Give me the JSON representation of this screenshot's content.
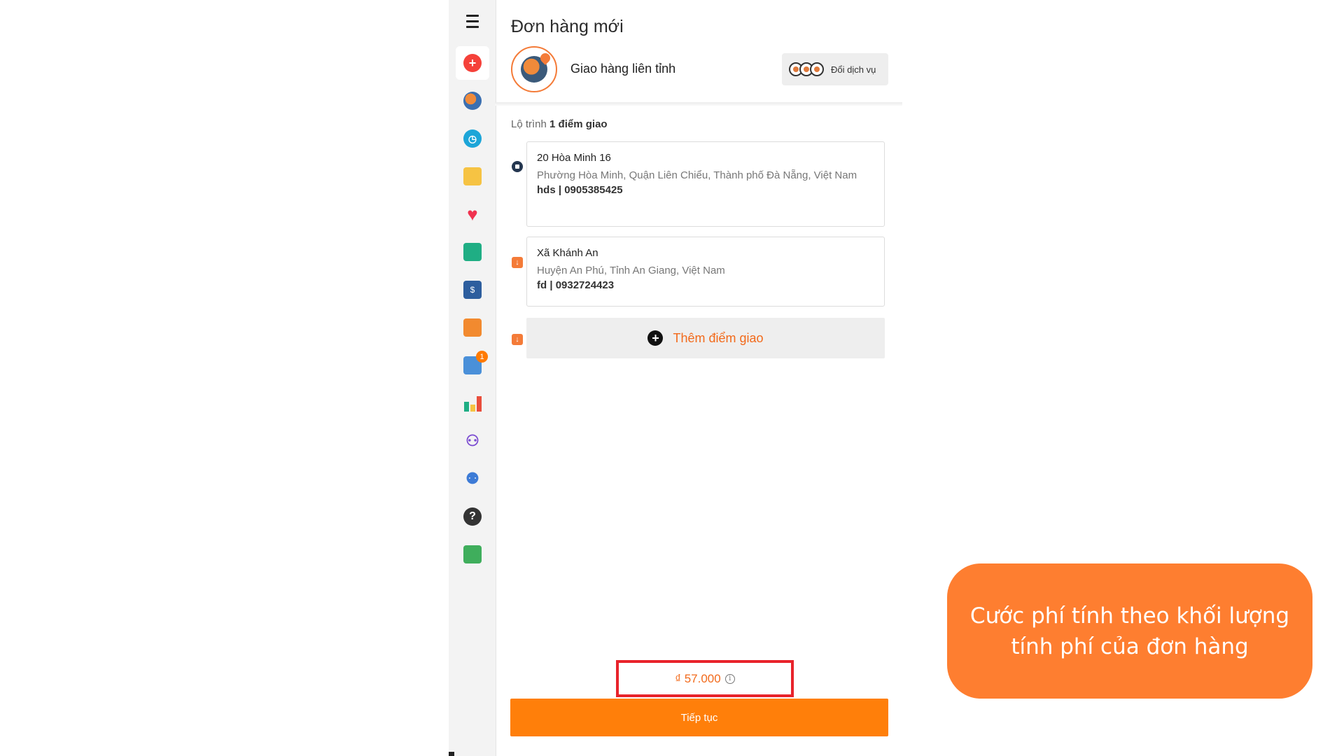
{
  "sidebar": {
    "menu_icon": "hamburger-menu-icon",
    "items": [
      {
        "name": "new-order",
        "icon": "plus-circle-icon",
        "color": "#f5413a",
        "active": true
      },
      {
        "name": "delivery",
        "icon": "delivery-globe-icon",
        "color": "#3b6fb0"
      },
      {
        "name": "history",
        "icon": "clock-icon",
        "color": "#1ca5d8"
      },
      {
        "name": "documents",
        "icon": "folder-icon",
        "color": "#f6c343"
      },
      {
        "name": "favorites",
        "icon": "heart-icon",
        "color": "#f0324f"
      },
      {
        "name": "wallet",
        "icon": "wallet-icon",
        "color": "#1fae84"
      },
      {
        "name": "cod",
        "icon": "money-box-icon",
        "color": "#2d5e9e"
      },
      {
        "name": "rewards",
        "icon": "gift-box-icon",
        "color": "#f28a2f"
      },
      {
        "name": "reports",
        "icon": "list-report-icon",
        "color": "#4a90d9",
        "badge": "1"
      },
      {
        "name": "statistics",
        "icon": "bar-chart-icon",
        "color": "#e94e3c"
      },
      {
        "name": "users",
        "icon": "people-icon",
        "color": "#7b4bd1"
      },
      {
        "name": "add-user",
        "icon": "user-add-icon",
        "color": "#3d7bd6"
      },
      {
        "name": "help",
        "icon": "question-icon",
        "color": "#333333"
      },
      {
        "name": "team",
        "icon": "team-icon",
        "color": "#3fae5c"
      }
    ]
  },
  "header": {
    "title": "Đơn hàng mới",
    "service_name": "Giao hàng liên tỉnh",
    "change_service": "Đổi dịch vụ"
  },
  "route": {
    "label_prefix": "Lộ trình",
    "label_count": "1 điểm giao",
    "stops": [
      {
        "street": "20 Hòa Minh 16",
        "area": "Phường Hòa Minh, Quận Liên Chiểu, Thành phố Đà Nẵng, Việt Nam",
        "contact": "hds | 0905385425"
      },
      {
        "street": "Xã Khánh An",
        "area": "Huyện An Phú, Tỉnh An Giang, Việt Nam",
        "contact": "fd | 0932724423"
      }
    ],
    "add_stop": "Thêm điểm giao"
  },
  "footer": {
    "price": "₫ 57.000",
    "info_glyph": "i",
    "continue": "Tiếp tục"
  },
  "callout": {
    "text": "Cước phí tính theo khối lượng tính phí của đơn hàng"
  },
  "colors": {
    "accent": "#ff7f0a",
    "highlight_border": "#e8232b",
    "callout_bg": "#fe7e30"
  }
}
